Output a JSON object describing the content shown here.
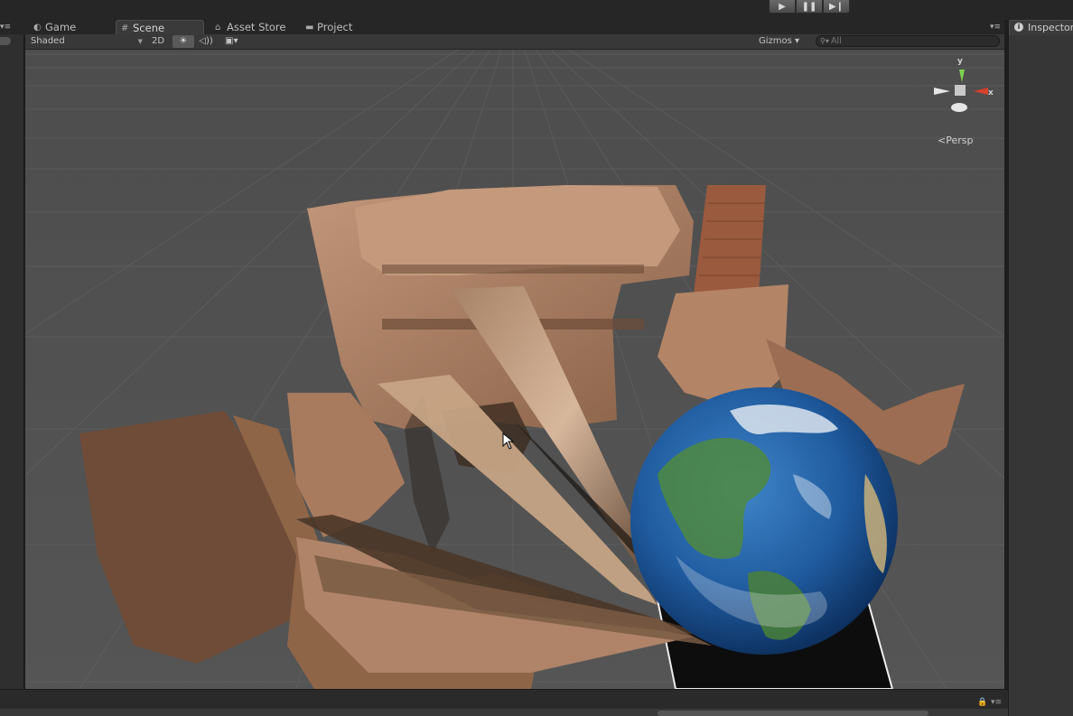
{
  "window": {
    "play_controls": [
      {
        "name": "play",
        "glyph": "▶"
      },
      {
        "name": "pause",
        "glyph": "❚❚"
      },
      {
        "name": "step",
        "glyph": "▶❙"
      }
    ]
  },
  "tabs": [
    {
      "label": "Game",
      "icon": "game-icon",
      "glyph": "◐"
    },
    {
      "label": "Scene",
      "icon": "scene-grid-icon",
      "glyph": "#",
      "active": true
    },
    {
      "label": "Asset Store",
      "icon": "lock-bag-icon",
      "glyph": "⌂"
    },
    {
      "label": "Project",
      "icon": "folder-icon",
      "glyph": "▬"
    }
  ],
  "toolbar": {
    "draw_mode": "Shaded",
    "mode_2d": "2D",
    "lighting_glyph": "☀",
    "audio_glyph": "◁))",
    "effects_glyph": "▣▾",
    "gizmos": "Gizmos ▾",
    "search_placeholder": "All"
  },
  "scene_view": {
    "orientation_gizmo": {
      "y": "y",
      "x": "x",
      "projection": "Persp"
    },
    "objects": [
      "scanned room mesh",
      "earth sphere",
      "black plane"
    ]
  },
  "inspector": {
    "title": "Inspector"
  },
  "colors": {
    "accent_active_tab": "#3a3a3a",
    "gizmo_y": "#7fd34e",
    "gizmo_x": "#d9402b",
    "background_grid": "#525252"
  }
}
